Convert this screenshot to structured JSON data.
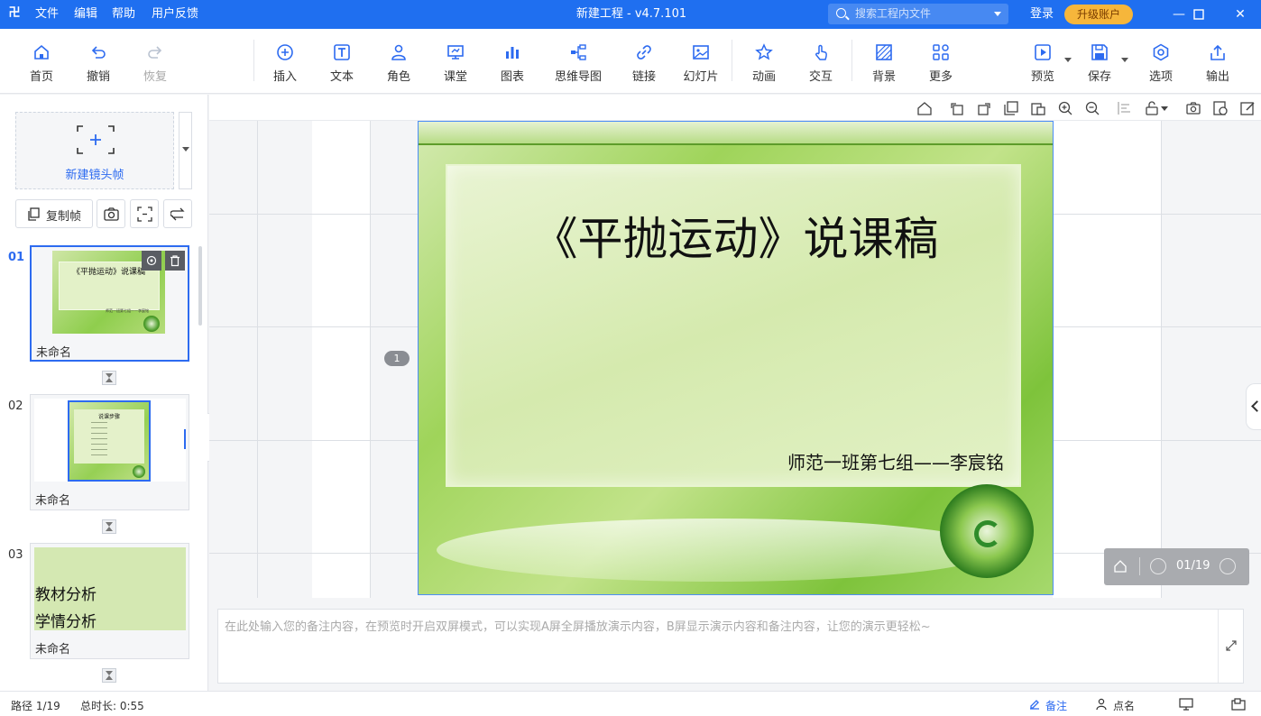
{
  "app": {
    "logo": "卍",
    "title": "新建工程 - v4.7.101",
    "menu": [
      "文件",
      "编辑",
      "帮助",
      "用户反馈"
    ],
    "search_placeholder": "搜索工程内文件",
    "login": "登录",
    "upgrade": "升级账户"
  },
  "toolbar": {
    "home": "首页",
    "undo": "撤销",
    "redo": "恢复",
    "insert": "插入",
    "text": "文本",
    "role": "角色",
    "classroom": "课堂",
    "chart": "图表",
    "mindmap": "思维导图",
    "link": "链接",
    "slideshow": "幻灯片",
    "animation": "动画",
    "interact": "交互",
    "background": "背景",
    "more": "更多",
    "preview": "预览",
    "save": "保存",
    "options": "选项",
    "export": "输出"
  },
  "leftpanel": {
    "new_frame": "新建镜头帧",
    "copy_frame": "复制帧",
    "slides": [
      {
        "num": "01",
        "caption": "未命名",
        "thumb_title": "《平抛运动》说课稿",
        "thumb_sub": "师范一班第七组——李宸铭"
      },
      {
        "num": "02",
        "caption": "未命名",
        "thumb_title": "说课步骤"
      },
      {
        "num": "03",
        "caption": "未命名",
        "thumb_lines": [
          "教材分析",
          "学情分析"
        ]
      }
    ]
  },
  "canvas": {
    "frame_badge": "1",
    "slide_title": "《平抛运动》说课稿",
    "slide_subtitle": "师范一班第七组——李宸铭",
    "page_indicator": "01/19"
  },
  "notes": {
    "placeholder": "在此处输入您的备注内容，在预览时开启双屏模式，可以实现A屏全屏播放演示内容，B屏显示演示内容和备注内容，让您的演示更轻松~"
  },
  "status": {
    "path": "路径 1/19",
    "duration": "总时长: 0:55",
    "notes_label": "备注",
    "rollcall": "点名"
  },
  "colors": {
    "accent": "#1f6ff0",
    "upgrade": "#f6b63b"
  }
}
